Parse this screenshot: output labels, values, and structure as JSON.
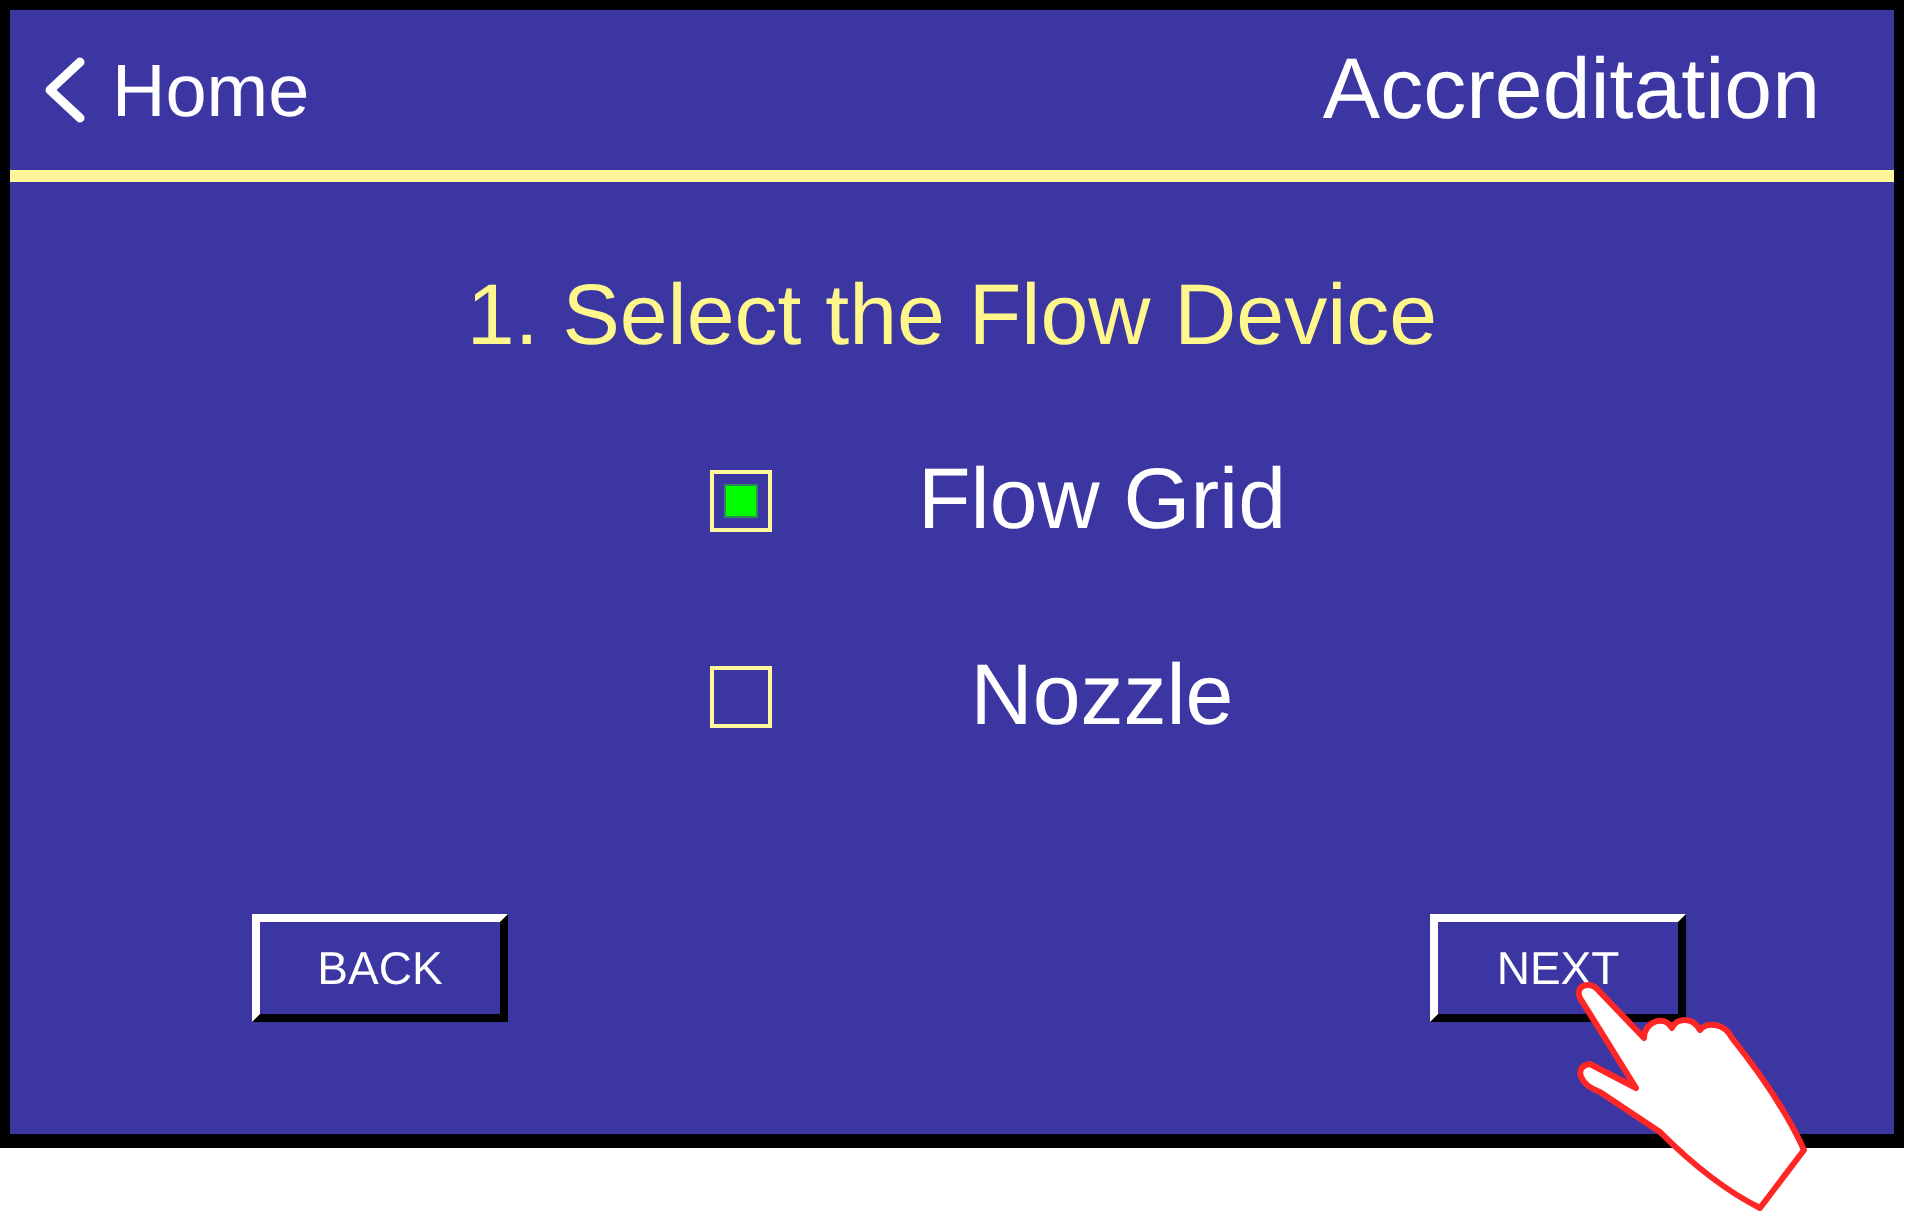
{
  "header": {
    "back_link": "Home",
    "title": "Accreditation"
  },
  "step_title": "1. Select the Flow Device",
  "options": [
    {
      "label": "Flow Grid",
      "checked": true
    },
    {
      "label": "Nozzle",
      "checked": false
    }
  ],
  "buttons": [
    {
      "label": "BACK"
    },
    {
      "label": "NEXT"
    }
  ]
}
